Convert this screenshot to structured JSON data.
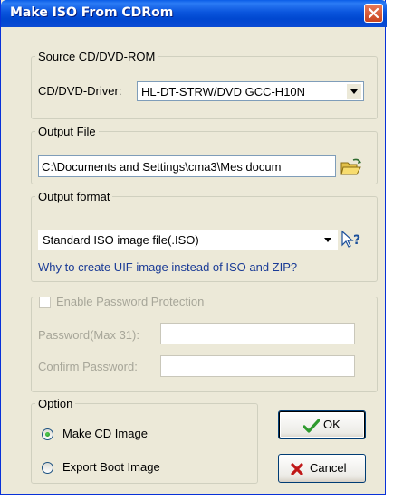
{
  "window": {
    "title": "Make ISO From CDRom",
    "close_icon": "close-icon"
  },
  "source": {
    "group_label": "Source CD/DVD-ROM",
    "drive_label": "CD/DVD-Driver:",
    "drive_value": "HL-DT-STRW/DVD GCC-H10N"
  },
  "output_file": {
    "group_label": "Output File",
    "path_value": "C:\\Documents and Settings\\cma3\\Mes docum",
    "browse_icon": "folder-open-icon"
  },
  "output_format": {
    "group_label": "Output format",
    "format_value": "Standard ISO image file(.ISO)",
    "help_icon": "help-pointer-icon",
    "link_text": "Why to create UIF image instead of ISO and ZIP?"
  },
  "password": {
    "enable_label": "Enable Password Protection",
    "password_label": "Password(Max 31):",
    "confirm_label": "Confirm Password:",
    "password_value": "",
    "confirm_value": ""
  },
  "option": {
    "group_label": "Option",
    "make_cd_label": "Make CD Image",
    "export_boot_label": "Export Boot Image",
    "selected": "Make CD Image"
  },
  "buttons": {
    "ok_label": "OK",
    "cancel_label": "Cancel"
  },
  "colors": {
    "titlebar": "#0a55dd",
    "window_bg": "#ece9d8",
    "link": "#1a3b96",
    "ok_check": "#2e9a2e",
    "cancel_x": "#c01818"
  }
}
